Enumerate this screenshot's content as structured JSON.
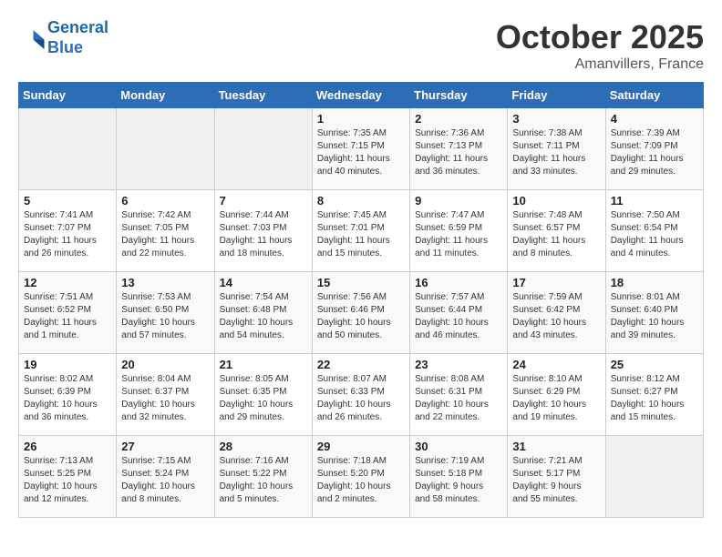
{
  "header": {
    "logo_line1": "General",
    "logo_line2": "Blue",
    "month": "October 2025",
    "location": "Amanvillers, France"
  },
  "weekdays": [
    "Sunday",
    "Monday",
    "Tuesday",
    "Wednesday",
    "Thursday",
    "Friday",
    "Saturday"
  ],
  "weeks": [
    [
      {
        "day": "",
        "info": ""
      },
      {
        "day": "",
        "info": ""
      },
      {
        "day": "",
        "info": ""
      },
      {
        "day": "1",
        "info": "Sunrise: 7:35 AM\nSunset: 7:15 PM\nDaylight: 11 hours\nand 40 minutes."
      },
      {
        "day": "2",
        "info": "Sunrise: 7:36 AM\nSunset: 7:13 PM\nDaylight: 11 hours\nand 36 minutes."
      },
      {
        "day": "3",
        "info": "Sunrise: 7:38 AM\nSunset: 7:11 PM\nDaylight: 11 hours\nand 33 minutes."
      },
      {
        "day": "4",
        "info": "Sunrise: 7:39 AM\nSunset: 7:09 PM\nDaylight: 11 hours\nand 29 minutes."
      }
    ],
    [
      {
        "day": "5",
        "info": "Sunrise: 7:41 AM\nSunset: 7:07 PM\nDaylight: 11 hours\nand 26 minutes."
      },
      {
        "day": "6",
        "info": "Sunrise: 7:42 AM\nSunset: 7:05 PM\nDaylight: 11 hours\nand 22 minutes."
      },
      {
        "day": "7",
        "info": "Sunrise: 7:44 AM\nSunset: 7:03 PM\nDaylight: 11 hours\nand 18 minutes."
      },
      {
        "day": "8",
        "info": "Sunrise: 7:45 AM\nSunset: 7:01 PM\nDaylight: 11 hours\nand 15 minutes."
      },
      {
        "day": "9",
        "info": "Sunrise: 7:47 AM\nSunset: 6:59 PM\nDaylight: 11 hours\nand 11 minutes."
      },
      {
        "day": "10",
        "info": "Sunrise: 7:48 AM\nSunset: 6:57 PM\nDaylight: 11 hours\nand 8 minutes."
      },
      {
        "day": "11",
        "info": "Sunrise: 7:50 AM\nSunset: 6:54 PM\nDaylight: 11 hours\nand 4 minutes."
      }
    ],
    [
      {
        "day": "12",
        "info": "Sunrise: 7:51 AM\nSunset: 6:52 PM\nDaylight: 11 hours\nand 1 minute."
      },
      {
        "day": "13",
        "info": "Sunrise: 7:53 AM\nSunset: 6:50 PM\nDaylight: 10 hours\nand 57 minutes."
      },
      {
        "day": "14",
        "info": "Sunrise: 7:54 AM\nSunset: 6:48 PM\nDaylight: 10 hours\nand 54 minutes."
      },
      {
        "day": "15",
        "info": "Sunrise: 7:56 AM\nSunset: 6:46 PM\nDaylight: 10 hours\nand 50 minutes."
      },
      {
        "day": "16",
        "info": "Sunrise: 7:57 AM\nSunset: 6:44 PM\nDaylight: 10 hours\nand 46 minutes."
      },
      {
        "day": "17",
        "info": "Sunrise: 7:59 AM\nSunset: 6:42 PM\nDaylight: 10 hours\nand 43 minutes."
      },
      {
        "day": "18",
        "info": "Sunrise: 8:01 AM\nSunset: 6:40 PM\nDaylight: 10 hours\nand 39 minutes."
      }
    ],
    [
      {
        "day": "19",
        "info": "Sunrise: 8:02 AM\nSunset: 6:39 PM\nDaylight: 10 hours\nand 36 minutes."
      },
      {
        "day": "20",
        "info": "Sunrise: 8:04 AM\nSunset: 6:37 PM\nDaylight: 10 hours\nand 32 minutes."
      },
      {
        "day": "21",
        "info": "Sunrise: 8:05 AM\nSunset: 6:35 PM\nDaylight: 10 hours\nand 29 minutes."
      },
      {
        "day": "22",
        "info": "Sunrise: 8:07 AM\nSunset: 6:33 PM\nDaylight: 10 hours\nand 26 minutes."
      },
      {
        "day": "23",
        "info": "Sunrise: 8:08 AM\nSunset: 6:31 PM\nDaylight: 10 hours\nand 22 minutes."
      },
      {
        "day": "24",
        "info": "Sunrise: 8:10 AM\nSunset: 6:29 PM\nDaylight: 10 hours\nand 19 minutes."
      },
      {
        "day": "25",
        "info": "Sunrise: 8:12 AM\nSunset: 6:27 PM\nDaylight: 10 hours\nand 15 minutes."
      }
    ],
    [
      {
        "day": "26",
        "info": "Sunrise: 7:13 AM\nSunset: 5:25 PM\nDaylight: 10 hours\nand 12 minutes."
      },
      {
        "day": "27",
        "info": "Sunrise: 7:15 AM\nSunset: 5:24 PM\nDaylight: 10 hours\nand 8 minutes."
      },
      {
        "day": "28",
        "info": "Sunrise: 7:16 AM\nSunset: 5:22 PM\nDaylight: 10 hours\nand 5 minutes."
      },
      {
        "day": "29",
        "info": "Sunrise: 7:18 AM\nSunset: 5:20 PM\nDaylight: 10 hours\nand 2 minutes."
      },
      {
        "day": "30",
        "info": "Sunrise: 7:19 AM\nSunset: 5:18 PM\nDaylight: 9 hours\nand 58 minutes."
      },
      {
        "day": "31",
        "info": "Sunrise: 7:21 AM\nSunset: 5:17 PM\nDaylight: 9 hours\nand 55 minutes."
      },
      {
        "day": "",
        "info": ""
      }
    ]
  ]
}
